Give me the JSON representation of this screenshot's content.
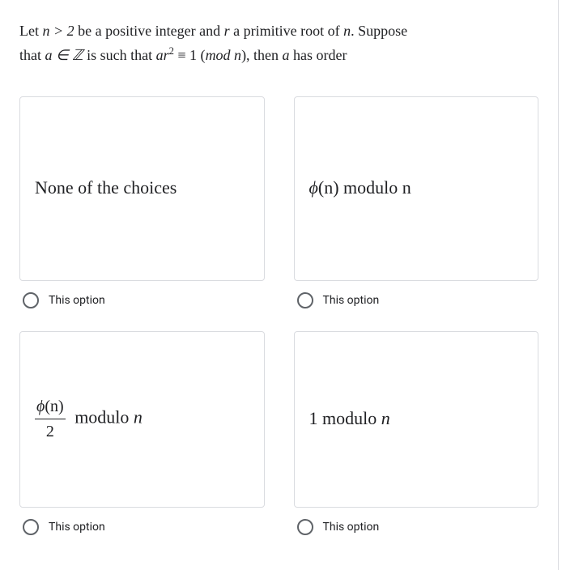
{
  "question": {
    "line1_prefix": "Let ",
    "line1_cond": "n > 2",
    "line1_mid1": " be a positive integer and ",
    "line1_r": "r",
    "line1_mid2": " a primitive root of ",
    "line1_n": "n",
    "line1_end": ". Suppose",
    "line2_prefix": "that ",
    "line2_a_in_z": "a ∈ ℤ",
    "line2_mid1": " is such that ",
    "line2_ar": "ar",
    "line2_sup": "2",
    "line2_equiv": " ≡ 1 (",
    "line2_mod": "mod n",
    "line2_close": "), then ",
    "line2_a": "a",
    "line2_end": " has order"
  },
  "options": [
    {
      "type": "text",
      "content": "None of the choices",
      "radio_label": "This option"
    },
    {
      "type": "phi_mod",
      "phi": "ϕ",
      "n": "(n)",
      "suffix": " modulo n",
      "radio_label": "This option"
    },
    {
      "type": "frac_phi_mod",
      "phi": "ϕ",
      "n": "(n)",
      "den": "2",
      "suffix": " modulo ",
      "suffix_n": "n",
      "radio_label": "This option"
    },
    {
      "type": "one_mod",
      "one": "1",
      "suffix": " modulo ",
      "suffix_n": "n",
      "radio_label": "This option"
    }
  ]
}
